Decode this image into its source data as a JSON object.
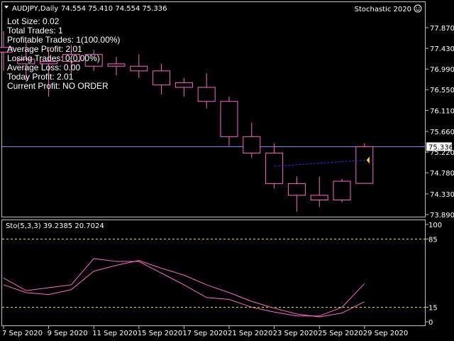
{
  "header": {
    "symbol": "AUDJPY,Daily",
    "ohlc": "74.554 75.410 74.554 75.336",
    "indicator_name": "Stochastic 2020"
  },
  "stats": [
    "Lot Size: 0.02",
    "Total Trades: 1",
    "Profitable Trades: 1(100.00%)",
    "Average Profit: 2.01",
    "Losing Trades: 0(0.00%)",
    "Average Loss: 0.00",
    "Today Profit: 2.01",
    "Current Profit: NO ORDER"
  ],
  "colors": {
    "background": "#000000",
    "candle": "#ff66cc",
    "price_line": "#8080ff",
    "trade_line": "#2233ff",
    "arrow": "#ffe000",
    "level": "#e6e61a",
    "frame": "#c0c0c0"
  },
  "chart_data": [
    {
      "type": "candlestick",
      "current_price": "75.336",
      "ylim": [
        73.8,
        77.9
      ],
      "yticks": [
        "77.870",
        "77.430",
        "76.990",
        "76.550",
        "76.110",
        "75.660",
        "75.220",
        "74.780",
        "74.330",
        "73.890"
      ],
      "x": [
        "7 Sep 2020",
        "8 Sep 2020",
        "9 Sep 2020",
        "10 Sep 2020",
        "11 Sep 2020",
        "14 Sep 2020",
        "15 Sep 2020",
        "16 Sep 2020",
        "17 Sep 2020",
        "18 Sep 2020",
        "21 Sep 2020",
        "22 Sep 2020",
        "23 Sep 2020",
        "24 Sep 2020",
        "25 Sep 2020",
        "28 Sep 2020",
        "29 Sep 2020"
      ],
      "xtick_labels": [
        "7 Sep 2020",
        "9 Sep 2020",
        "11 Sep 2020",
        "15 Sep 2020",
        "17 Sep 2020",
        "21 Sep 2020",
        "23 Sep 2020",
        "25 Sep 2020",
        "29 Sep 2020"
      ],
      "ohlc": [
        [
          77.35,
          77.8,
          76.95,
          77.45
        ],
        [
          77.2,
          77.55,
          76.75,
          77.1
        ],
        [
          77.1,
          77.4,
          76.4,
          77.15
        ],
        [
          77.15,
          77.5,
          76.9,
          77.3
        ],
        [
          77.3,
          77.4,
          76.95,
          77.05
        ],
        [
          77.05,
          77.25,
          76.85,
          77.1
        ],
        [
          76.95,
          77.3,
          76.8,
          77.05
        ],
        [
          76.95,
          77.1,
          76.45,
          76.65
        ],
        [
          76.7,
          76.8,
          76.4,
          76.6
        ],
        [
          76.6,
          76.9,
          76.15,
          76.3
        ],
        [
          76.3,
          76.4,
          75.35,
          75.55
        ],
        [
          75.55,
          75.85,
          75.1,
          75.2
        ],
        [
          75.2,
          75.4,
          74.45,
          74.55
        ],
        [
          74.55,
          74.7,
          73.95,
          74.3
        ],
        [
          74.3,
          74.7,
          74.05,
          74.2
        ],
        [
          74.2,
          74.65,
          74.15,
          74.6
        ],
        [
          74.554,
          75.41,
          74.554,
          75.336
        ]
      ],
      "trade_line": {
        "from": [
          "23 Sep 2020",
          74.92
        ],
        "to": [
          "29 Sep 2020",
          75.05
        ]
      }
    },
    {
      "type": "line",
      "label": "Sto(5,3,3) 39.2385 20.7024",
      "ylim": [
        0,
        100
      ],
      "yticks": [
        "100",
        "85",
        "15",
        "0"
      ],
      "levels": [
        85,
        15
      ],
      "x": [
        "7 Sep 2020",
        "8 Sep 2020",
        "9 Sep 2020",
        "10 Sep 2020",
        "11 Sep 2020",
        "14 Sep 2020",
        "15 Sep 2020",
        "16 Sep 2020",
        "17 Sep 2020",
        "18 Sep 2020",
        "21 Sep 2020",
        "22 Sep 2020",
        "23 Sep 2020",
        "24 Sep 2020",
        "25 Sep 2020",
        "28 Sep 2020",
        "29 Sep 2020"
      ],
      "series": [
        {
          "values": [
            45,
            32,
            35,
            38,
            65,
            62,
            62,
            50,
            38,
            25,
            23,
            15,
            10,
            6,
            6,
            15,
            39.2
          ]
        },
        {
          "values": [
            38,
            30,
            28,
            33,
            52,
            58,
            63,
            55,
            48,
            38,
            30,
            21,
            14,
            8,
            5,
            9,
            20.7
          ]
        }
      ]
    }
  ]
}
